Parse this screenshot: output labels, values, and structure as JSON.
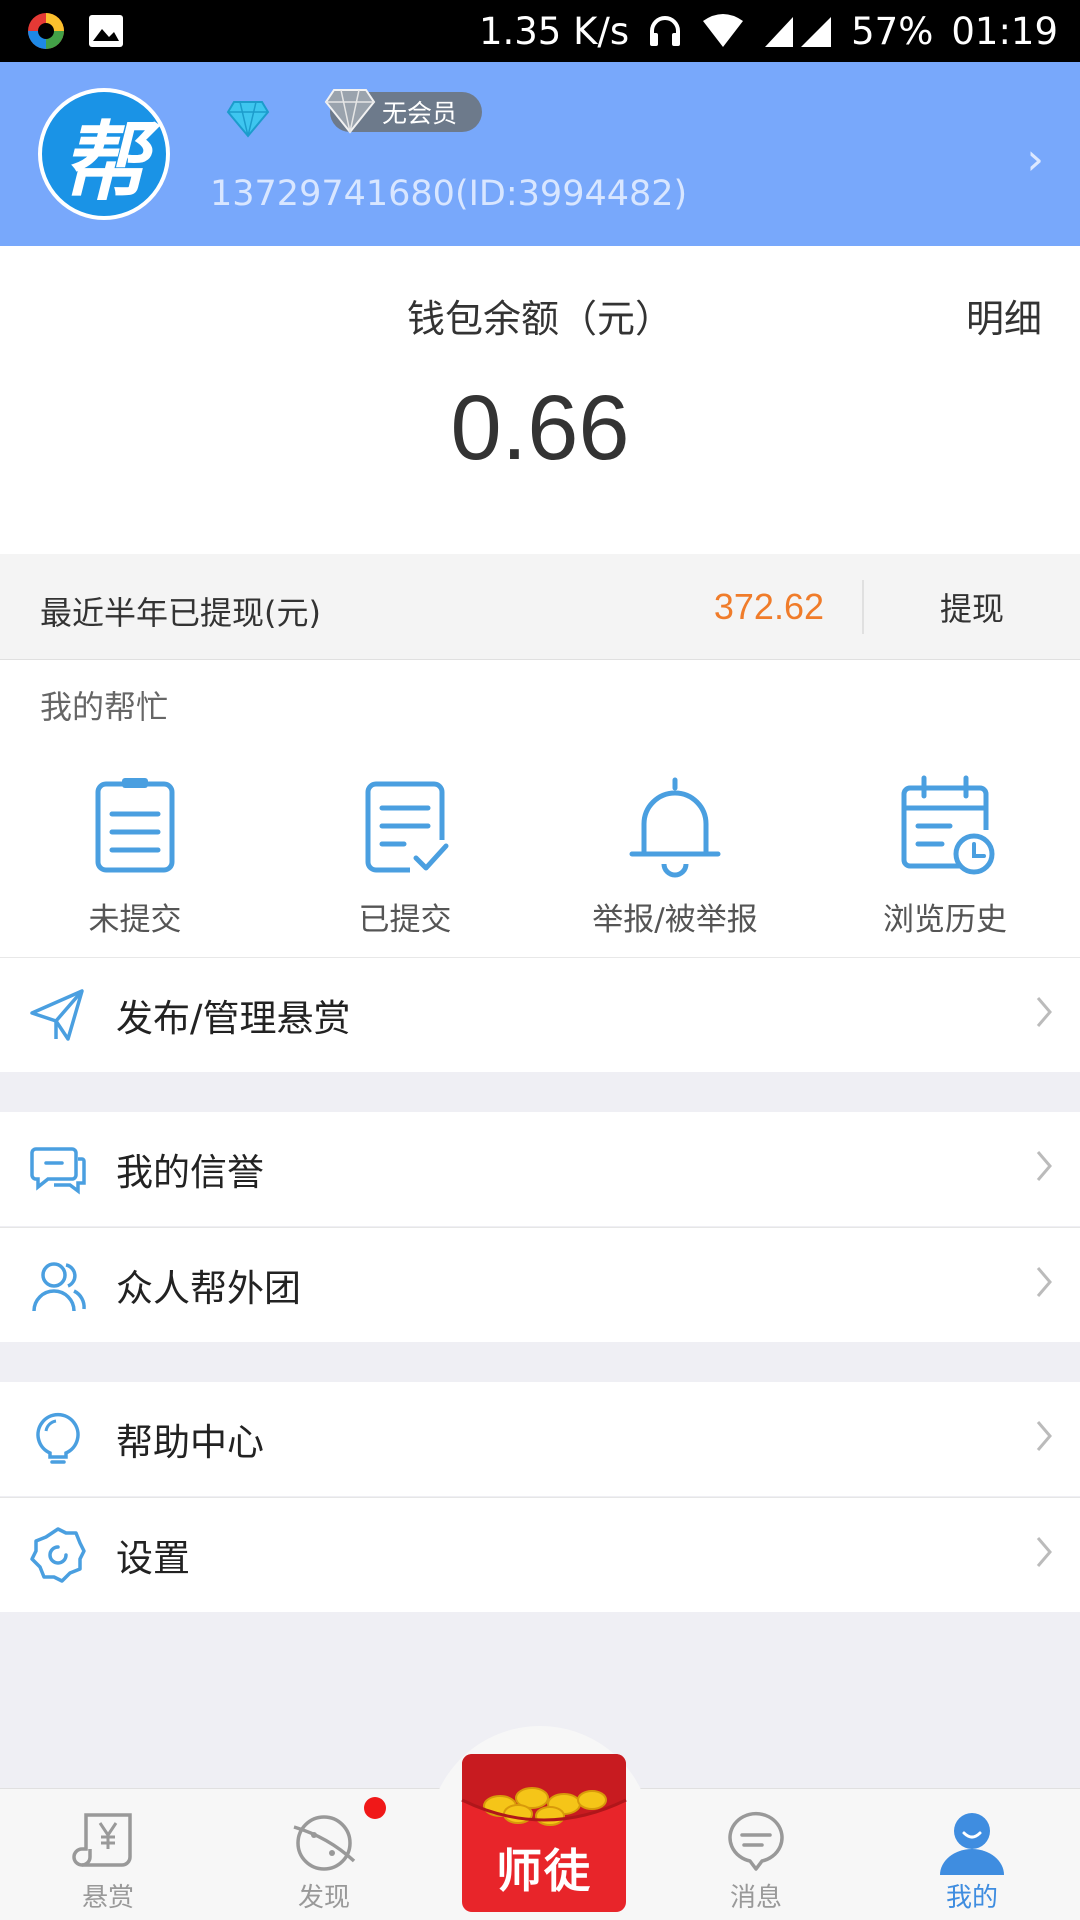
{
  "status_bar": {
    "speed": "1.35 K/s",
    "battery": "57%",
    "time": "01:19"
  },
  "header": {
    "avatar_char": "帮",
    "member_badge": "无会员",
    "user_id": "13729741680(ID:3994482)"
  },
  "wallet": {
    "label": "钱包余额（元）",
    "detail": "明细",
    "amount": "0.66"
  },
  "withdraw": {
    "label": "最近半年已提现(元)",
    "amount": "372.62",
    "button": "提现"
  },
  "help": {
    "title": "我的帮忙",
    "items": [
      {
        "label": "未提交",
        "icon": "clipboard-icon"
      },
      {
        "label": "已提交",
        "icon": "clipboard-check-icon"
      },
      {
        "label": "举报/被举报",
        "icon": "bell-icon"
      },
      {
        "label": "浏览历史",
        "icon": "calendar-clock-icon"
      }
    ]
  },
  "menu": [
    {
      "label": "发布/管理悬赏",
      "icon": "paper-plane-icon"
    },
    {
      "label": "我的信誉",
      "icon": "chat-bubbles-icon"
    },
    {
      "label": "众人帮外团",
      "icon": "people-icon"
    },
    {
      "label": "帮助中心",
      "icon": "lightbulb-icon"
    },
    {
      "label": "设置",
      "icon": "gear-icon"
    }
  ],
  "nav": [
    {
      "label": "悬赏",
      "icon": "scroll-yen-icon"
    },
    {
      "label": "发现",
      "icon": "planet-icon"
    },
    {
      "label": "师徒",
      "icon": "red-packet-icon"
    },
    {
      "label": "消息",
      "icon": "chat-heart-icon"
    },
    {
      "label": "我的",
      "icon": "user-icon"
    }
  ],
  "colors": {
    "header_bg": "#78a8fb",
    "accent": "#3f8de0",
    "icon_blue": "#4a9fe0",
    "withdraw_amount": "#f07c2a",
    "red_dot": "#f01818"
  }
}
